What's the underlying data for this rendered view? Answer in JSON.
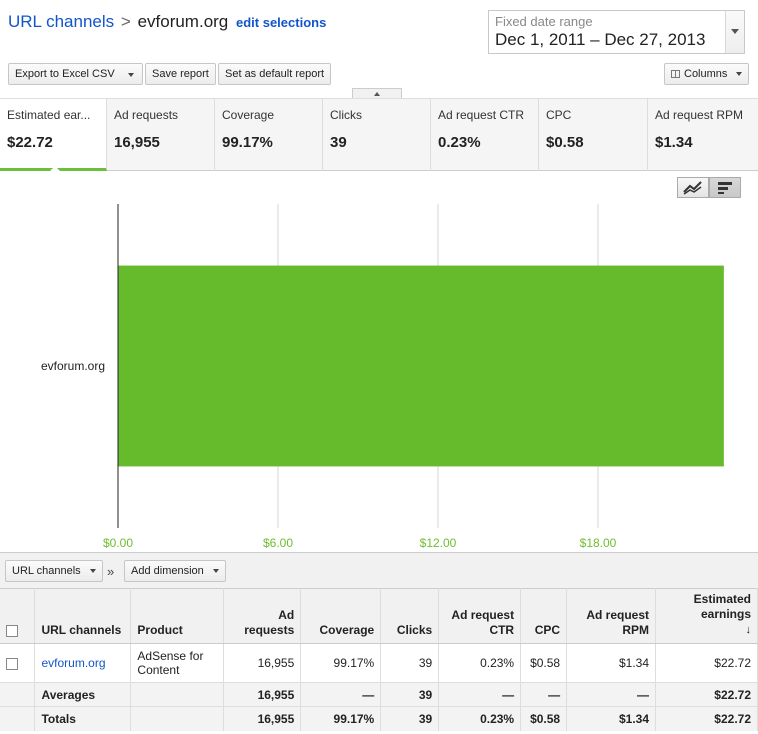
{
  "header": {
    "breadcrumb_root": "URL channels",
    "breadcrumb_separator": ">",
    "breadcrumb_current": "evforum.org",
    "edit_selections": "edit selections",
    "date_range_label": "Fixed date range",
    "date_range_value": "Dec 1, 2011 – Dec 27, 2013"
  },
  "toolbar": {
    "export_label": "Export to Excel CSV",
    "save_label": "Save report",
    "default_label": "Set as default report",
    "columns_label": "Columns"
  },
  "metrics": [
    {
      "name": "Estimated ear...",
      "value": "$22.72"
    },
    {
      "name": "Ad requests",
      "value": "16,955"
    },
    {
      "name": "Coverage",
      "value": "99.17%"
    },
    {
      "name": "Clicks",
      "value": "39"
    },
    {
      "name": "Ad request CTR",
      "value": "0.23%"
    },
    {
      "name": "CPC",
      "value": "$0.58"
    },
    {
      "name": "Ad request RPM",
      "value": "$1.34"
    }
  ],
  "chart_data": {
    "type": "bar",
    "orientation": "horizontal",
    "categories": [
      "evforum.org"
    ],
    "values": [
      22.72
    ],
    "xlim": [
      0,
      24
    ],
    "xticks": [
      0,
      6,
      12,
      18
    ],
    "xtick_labels": [
      "$0.00",
      "$6.00",
      "$12.00",
      "$18.00"
    ],
    "bar_color": "#66bb2d",
    "tick_color": "#6cbf2e",
    "grid": true
  },
  "dimensions": {
    "dimension_label": "URL channels",
    "separator": "»",
    "add_dimension_label": "Add dimension"
  },
  "table": {
    "headers": {
      "channel": "URL channels",
      "product": "Product",
      "ad_requests": "Ad requests",
      "coverage": "Coverage",
      "clicks": "Clicks",
      "ctr": "Ad request CTR",
      "cpc": "CPC",
      "rpm": "Ad request RPM",
      "earnings": "Estimated earnings",
      "sort_indicator": "↓"
    },
    "rows": [
      {
        "channel": "evforum.org",
        "product": "AdSense for Content",
        "ad_requests": "16,955",
        "coverage": "99.17%",
        "clicks": "39",
        "ctr": "0.23%",
        "cpc": "$0.58",
        "rpm": "$1.34",
        "earnings": "$22.72"
      }
    ],
    "averages": {
      "label": "Averages",
      "ad_requests": "16,955",
      "coverage": "—",
      "clicks": "39",
      "ctr": "—",
      "cpc": "—",
      "rpm": "—",
      "earnings": "$22.72"
    },
    "totals": {
      "label": "Totals",
      "ad_requests": "16,955",
      "coverage": "99.17%",
      "clicks": "39",
      "ctr": "0.23%",
      "cpc": "$0.58",
      "rpm": "$1.34",
      "earnings": "$22.72"
    }
  }
}
